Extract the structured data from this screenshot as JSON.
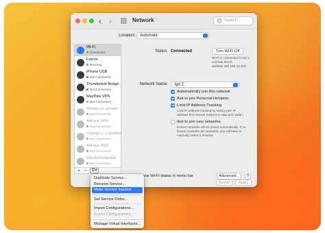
{
  "window": {
    "title": "Network",
    "search_placeholder": "Search"
  },
  "location": {
    "label": "Location:",
    "value": "Automatic"
  },
  "services": [
    {
      "name": "Wi-Fi",
      "status": "Connected",
      "status_color": "#34c759",
      "icon": "wifi-icon",
      "icon_color": "#2f7bf5"
    },
    {
      "name": "Falcon",
      "status": "Running",
      "status_color": "#34c759",
      "icon": "vpn-icon",
      "icon_color": "#3a3a3a"
    },
    {
      "name": "iPhone USB",
      "status": "Not Connected",
      "status_color": "#ff3b30",
      "icon": "phone-icon",
      "icon_color": "#3a3a3a"
    },
    {
      "name": "Thunderbolt Bridge",
      "status": "Not Connected",
      "status_color": "#ff3b30",
      "icon": "bridge-icon",
      "icon_color": "#3a3a3a"
    },
    {
      "name": "MacPaw VPN",
      "status": "Not Connected",
      "status_color": "#9a9a9a",
      "icon": "vpn-icon",
      "icon_color": "#3a3a3a"
    },
    {
      "name": "Browse in...private",
      "status": "Not Connected",
      "status_color": "#9a9a9a",
      "icon": "vpn-icon",
      "icon_color": "#3a3a3a"
    },
    {
      "name": "AdLock VPN",
      "status": "Not Connected",
      "status_color": "#9a9a9a",
      "icon": "vpn-icon",
      "icon_color": "#3a3a3a"
    },
    {
      "name": "Change y...r location",
      "status": "Not Connected",
      "status_color": "#9a9a9a",
      "icon": "vpn-icon",
      "icon_color": "#3a3a3a"
    },
    {
      "name": "AdLock DNS",
      "status": "Not Connected",
      "status_color": "#9a9a9a",
      "icon": "vpn-icon",
      "icon_color": "#3a3a3a"
    },
    {
      "name": "ElectricEndpoints",
      "status": "Not Connected",
      "status_color": "#9a9a9a",
      "icon": "vpn-icon",
      "icon_color": "#3a3a3a"
    }
  ],
  "sidebar_controls": {
    "add": "+",
    "remove": "−",
    "gear": "⚙▾"
  },
  "detail": {
    "status_label": "Status:",
    "status_value": "Connected",
    "turn_off_button": "Turn Wi-Fi Off",
    "status_desc_1": "Wi-Fi is connected to Apt 2 and has the IP",
    "status_desc_2": "address 192.168.16.104.",
    "network_label": "Network Name:",
    "network_value": "Apt 2",
    "checkboxes": [
      {
        "label": "Automatically join this network",
        "checked": true
      },
      {
        "label": "Ask to join Personal Hotspots",
        "checked": true
      },
      {
        "label": "Limit IP Address Tracking",
        "checked": true
      },
      {
        "label": "Ask to join new networks",
        "checked": false
      }
    ],
    "tracking_desc_1": "Limit IP address tracking by hiding your IP",
    "tracking_desc_2": "address from known trackers in Mail and Safari.",
    "new_desc_1": "Known networks will be joined automatically. If no",
    "new_desc_2": "known networks are available, you will have to",
    "new_desc_3": "manually select a network."
  },
  "bottom": {
    "show_wifi_label": "Show Wi-Fi status in menu bar",
    "advanced_button": "Advanced...",
    "help_button": "?",
    "revert_button": "Revert",
    "apply_button": "Apply"
  },
  "context_menu": [
    {
      "label": "Duplicate Service...",
      "state": "normal"
    },
    {
      "label": "Rename Service...",
      "state": "normal"
    },
    {
      "label": "Make Service Inactive",
      "state": "highlighted"
    },
    {
      "label": "Set Service Order...",
      "state": "normal"
    },
    {
      "label": "Import Configurations...",
      "state": "normal"
    },
    {
      "label": "Export Configurations...",
      "state": "disabled"
    },
    {
      "label": "Manage Virtual Interfaces...",
      "state": "normal"
    }
  ],
  "accent_color": "#2f7bf5"
}
